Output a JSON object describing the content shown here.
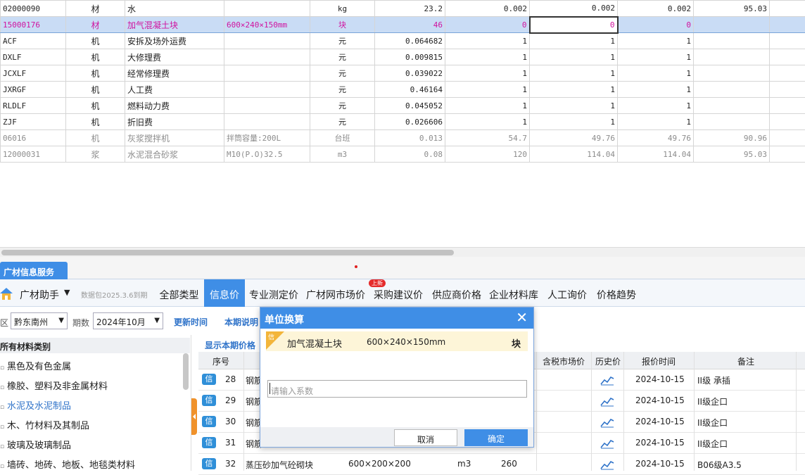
{
  "grid_rows": [
    {
      "code": "02000090",
      "type": "材",
      "name": "水",
      "spec": "",
      "unit": "kg",
      "qty": "23.2",
      "p1": "0.002",
      "p2": "0.002",
      "p3": "0.002",
      "p4": "95.03",
      "style": "normal"
    },
    {
      "code": "15000176",
      "type": "材",
      "name": "加气混凝土块",
      "spec": "600×240×150mm",
      "unit": "块",
      "qty": "46",
      "p1": "0",
      "p2": "0",
      "p3": "0",
      "p4": "",
      "style": "selected"
    },
    {
      "code": "ACF",
      "type": "机",
      "name": "安拆及场外运费",
      "spec": "",
      "unit": "元",
      "qty": "0.064682",
      "p1": "1",
      "p2": "1",
      "p3": "1",
      "p4": "",
      "style": "normal"
    },
    {
      "code": "DXLF",
      "type": "机",
      "name": "大修理费",
      "spec": "",
      "unit": "元",
      "qty": "0.009815",
      "p1": "1",
      "p2": "1",
      "p3": "1",
      "p4": "",
      "style": "normal"
    },
    {
      "code": "JCXLF",
      "type": "机",
      "name": "经常修理费",
      "spec": "",
      "unit": "元",
      "qty": "0.039022",
      "p1": "1",
      "p2": "1",
      "p3": "1",
      "p4": "",
      "style": "normal"
    },
    {
      "code": "JXRGF",
      "type": "机",
      "name": "人工费",
      "spec": "",
      "unit": "元",
      "qty": "0.46164",
      "p1": "1",
      "p2": "1",
      "p3": "1",
      "p4": "",
      "style": "normal"
    },
    {
      "code": "RLDLF",
      "type": "机",
      "name": "燃料动力费",
      "spec": "",
      "unit": "元",
      "qty": "0.045052",
      "p1": "1",
      "p2": "1",
      "p3": "1",
      "p4": "",
      "style": "normal"
    },
    {
      "code": "ZJF",
      "type": "机",
      "name": "折旧费",
      "spec": "",
      "unit": "元",
      "qty": "0.026606",
      "p1": "1",
      "p2": "1",
      "p3": "1",
      "p4": "",
      "style": "normal"
    },
    {
      "code": "06016",
      "type": "机",
      "name": "灰浆搅拌机",
      "spec": "拌筒容量:200L",
      "unit": "台班",
      "qty": "0.013",
      "p1": "54.7",
      "p2": "49.76",
      "p3": "49.76",
      "p4": "90.96",
      "style": "dim"
    },
    {
      "code": "12000031",
      "type": "浆",
      "name": "水泥混合砂浆",
      "spec": "M10(P.O)32.5",
      "unit": "m3",
      "qty": "0.08",
      "p1": "120",
      "p2": "114.04",
      "p3": "114.04",
      "p4": "95.03",
      "style": "dim"
    }
  ],
  "panel_tab": "广材信息服务",
  "brand": {
    "name": "广材助手",
    "caret": "▼",
    "data_package": "数据包2025.3.6到期"
  },
  "nav_tabs": [
    "全部类型",
    "信息价",
    "专业测定价",
    "广材网市场价",
    "采购建议价",
    "供应商价格",
    "企业材料库",
    "人工询价",
    "价格趋势"
  ],
  "nav_active": "信息价",
  "new_badge": "上新",
  "filters": {
    "region_label": "区",
    "region": "黔东南州",
    "period_label": "期数",
    "period": "2024年10月",
    "refresh": "更新时间",
    "notes": "本期说明"
  },
  "tree": {
    "header": "所有材料类别",
    "items": [
      "黑色及有色金属",
      "橡胶、塑料及非金属材料",
      "水泥及水泥制品",
      "木、竹材料及其制品",
      "玻璃及玻璃制品",
      "墙砖、地砖、地板、地毯类材料"
    ],
    "active_index": 2
  },
  "show_period": "显示本期价格",
  "grid_headers": {
    "seq": "序号",
    "market_price": "含税市场价",
    "history": "历史价",
    "quote_time": "报价时间",
    "remark": "备注"
  },
  "price_rows": [
    {
      "badge": "信",
      "seq": "28",
      "name": "钢筋",
      "spec": "",
      "unit": "",
      "price": "",
      "date": "2024-10-15",
      "remark": "II级 承插"
    },
    {
      "badge": "信",
      "seq": "29",
      "name": "钢筋",
      "spec": "",
      "unit": "",
      "price": "",
      "date": "2024-10-15",
      "remark": "II级企口"
    },
    {
      "badge": "信",
      "seq": "30",
      "name": "钢筋",
      "spec": "",
      "unit": "",
      "price": "",
      "date": "2024-10-15",
      "remark": "II级企口"
    },
    {
      "badge": "信",
      "seq": "31",
      "name": "钢筋",
      "spec": "",
      "unit": "",
      "price": "",
      "date": "2024-10-15",
      "remark": "II级企口"
    },
    {
      "badge": "信",
      "seq": "32",
      "name": "蒸压砂加气砼砌块",
      "spec": "600×200×200",
      "unit": "m3",
      "price": "260",
      "date": "2024-10-15",
      "remark": "B06级A3.5"
    }
  ],
  "dialog": {
    "title": "单位换算",
    "close": "✕",
    "tag": "信",
    "item_name": "加气混凝土块",
    "item_spec": "600×240×150mm",
    "item_unit": "块",
    "input_placeholder": "请输入系数",
    "cancel": "取消",
    "ok": "确定"
  },
  "colors": {
    "accent": "#3f8ee6",
    "selected_row_text": "#d0129f",
    "selected_row_bg": "#c9dcf5",
    "badge": "#2f8fd8",
    "new_badge": "#e52b2b",
    "tag": "#f3b53a"
  }
}
